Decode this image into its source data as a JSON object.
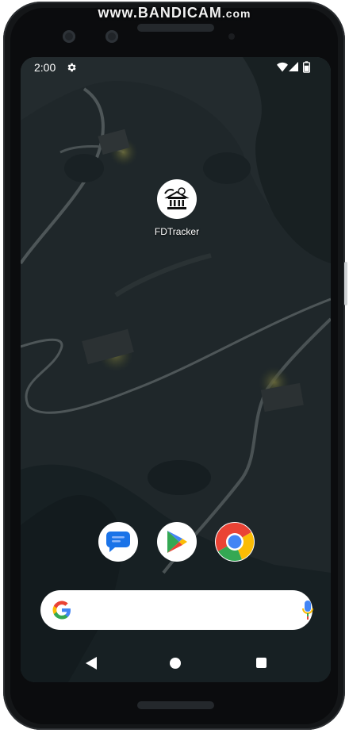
{
  "watermark": {
    "main": "www.BANDICAM",
    "suffix": ".com"
  },
  "status_bar": {
    "time": "2:00",
    "icons": [
      "settings-icon",
      "wifi-icon",
      "cell-signal-icon",
      "battery-icon"
    ]
  },
  "home": {
    "app": {
      "label": "FDTracker",
      "icon": "fdtracker-bank-icon"
    },
    "dock": [
      {
        "name": "messages-app",
        "icon": "messages-icon"
      },
      {
        "name": "play-store-app",
        "icon": "play-store-icon"
      },
      {
        "name": "chrome-app",
        "icon": "chrome-icon"
      }
    ]
  },
  "search_bar": {
    "left_icon": "google-g-icon",
    "right_icon": "microphone-icon"
  },
  "nav_bar": {
    "buttons": [
      "back-icon",
      "home-icon",
      "recents-icon"
    ]
  },
  "colors": {
    "google_blue": "#4285F4",
    "google_red": "#EA4335",
    "google_yellow": "#FBBC05",
    "google_green": "#34A853",
    "messages_blue": "#1A73E8"
  }
}
